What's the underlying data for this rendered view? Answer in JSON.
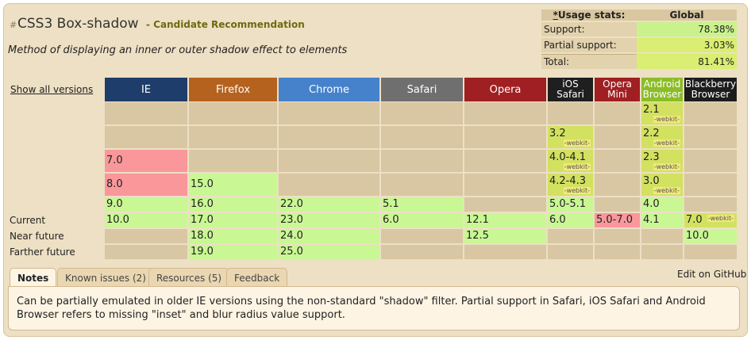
{
  "header": {
    "hash": "#",
    "title": "CSS3 Box-shadow",
    "status": "- Candidate Recommendation",
    "description": "Method of displaying an inner or outer shadow effect to elements"
  },
  "usage": {
    "asterisk": "*",
    "heading": "Usage stats:",
    "global_label": "Global",
    "rows": [
      {
        "label": "Support:",
        "value": "78.38%"
      },
      {
        "label": "Partial support:",
        "value": "3.03%"
      },
      {
        "label": "Total:",
        "value": "81.41%"
      }
    ]
  },
  "show_all_versions": "Show all versions",
  "browsers": [
    {
      "name": "IE",
      "color": "#1f3d6b"
    },
    {
      "name": "Firefox",
      "color": "#b5621f"
    },
    {
      "name": "Chrome",
      "color": "#4582cb"
    },
    {
      "name": "Safari",
      "color": "#6f6f6f"
    },
    {
      "name": "Opera",
      "color": "#a01f22"
    },
    {
      "name": "iOS Safari",
      "color": "#1f1f1f"
    },
    {
      "name": "Opera Mini",
      "color": "#a01f22"
    },
    {
      "name": "Android Browser",
      "color": "#8cbd28"
    },
    {
      "name": "Blackberry Browser",
      "color": "#1c1c1c"
    }
  ],
  "row_labels": {
    "current": "Current",
    "near": "Near future",
    "farther": "Farther future"
  },
  "prefix_label": "-webkit-",
  "support_colors": {
    "yes": "#c9f794",
    "no": "#f9979b",
    "partial": "#d2e160",
    "empty": "#d9c6a3"
  },
  "versions": {
    "ie": [
      "7.0",
      "8.0",
      "9.0",
      "10.0"
    ],
    "firefox": [
      "15.0",
      "16.0",
      "17.0",
      "18.0",
      "19.0"
    ],
    "chrome": [
      "22.0",
      "23.0",
      "24.0",
      "25.0"
    ],
    "safari": [
      "5.1",
      "6.0"
    ],
    "opera": [
      "12.1",
      "12.5"
    ],
    "ios": [
      "3.2",
      "4.0-4.1",
      "4.2-4.3",
      "5.0-5.1",
      "6.0"
    ],
    "opera_mini": [
      "5.0-7.0"
    ],
    "android": [
      "2.1",
      "2.2",
      "2.3",
      "3.0",
      "4.0",
      "4.1"
    ],
    "blackberry": [
      "7.0",
      "10.0"
    ]
  },
  "tabs": [
    "Notes",
    "Known issues (2)",
    "Resources (5)",
    "Feedback"
  ],
  "edit_on_github": "Edit on GitHub",
  "notes_text": "Can be partially emulated in older IE versions using the non-standard \"shadow\" filter. Partial support in Safari, iOS Safari and Android Browser refers to missing \"inset\" and blur radius value support."
}
